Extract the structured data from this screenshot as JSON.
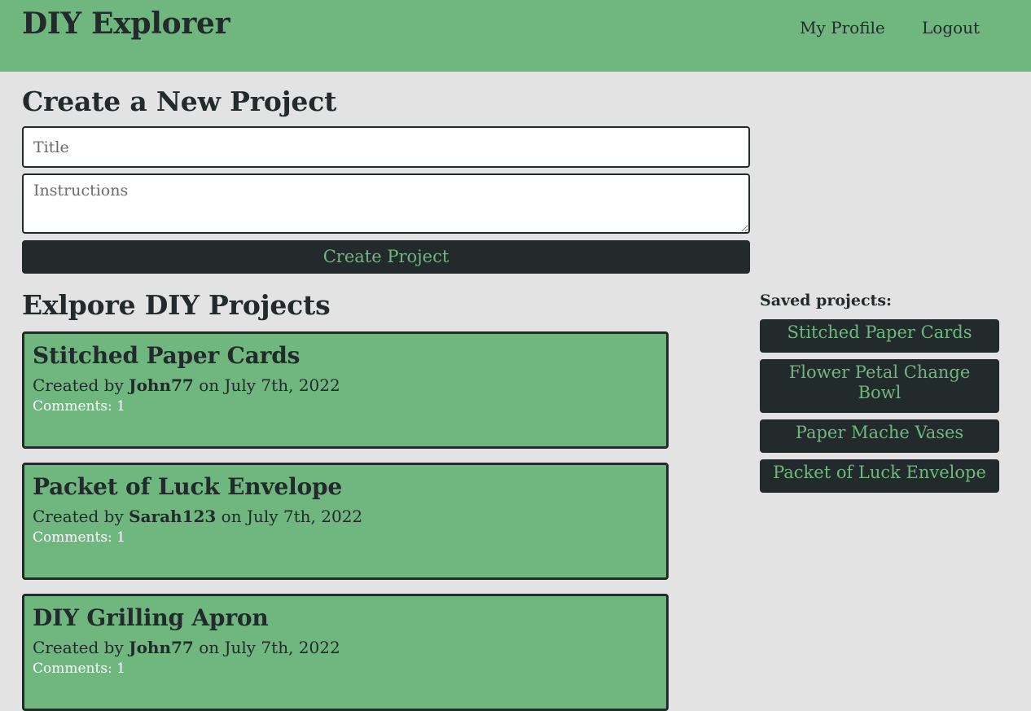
{
  "header": {
    "brand": "DIY Explorer",
    "nav": {
      "profile": "My Profile",
      "logout": "Logout"
    }
  },
  "create": {
    "heading": "Create a New Project",
    "title_placeholder": "Title",
    "instructions_placeholder": "Instructions",
    "button_label": "Create Project"
  },
  "explore": {
    "heading": "Exlpore DIY Projects",
    "projects": [
      {
        "title": "Stitched Paper Cards",
        "created_prefix": "Created by",
        "author": "John77",
        "date_text": "on July 7th, 2022",
        "comments": "Comments: 1"
      },
      {
        "title": "Packet of Luck Envelope",
        "created_prefix": "Created by",
        "author": "Sarah123",
        "date_text": "on July 7th, 2022",
        "comments": "Comments: 1"
      },
      {
        "title": "DIY Grilling Apron",
        "created_prefix": "Created by",
        "author": "John77",
        "date_text": "on July 7th, 2022",
        "comments": "Comments: 1"
      }
    ]
  },
  "saved": {
    "heading": "Saved projects:",
    "items": [
      "Stitched Paper Cards",
      "Flower Petal Change Bowl",
      "Paper Mache Vases",
      "Packet of Luck Envelope"
    ]
  },
  "colors": {
    "accent_green": "#70b77f",
    "dark": "#222a2c",
    "background": "#e3e3e3"
  }
}
